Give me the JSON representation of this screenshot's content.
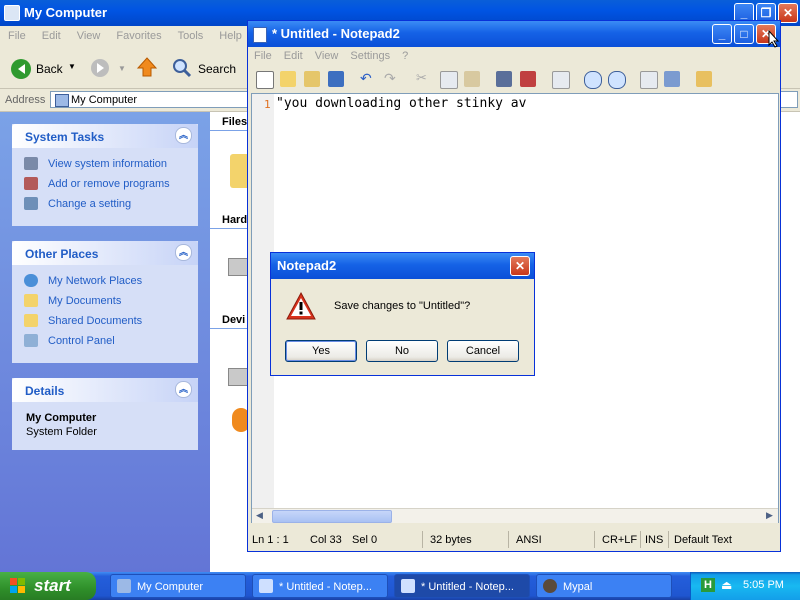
{
  "my_computer": {
    "title": "My Computer",
    "menu": [
      "File",
      "Edit",
      "View",
      "Favorites",
      "Tools",
      "Help"
    ],
    "toolbar": {
      "back": "Back",
      "search": "Search"
    },
    "address_label": "Address",
    "address_value": "My Computer",
    "system_tasks": {
      "title": "System Tasks",
      "items": [
        "View system information",
        "Add or remove programs",
        "Change a setting"
      ]
    },
    "other_places": {
      "title": "Other Places",
      "items": [
        "My Network Places",
        "My Documents",
        "Shared Documents",
        "Control Panel"
      ]
    },
    "details": {
      "title": "Details",
      "name": "My Computer",
      "type": "System Folder"
    },
    "content_sections": [
      "Files",
      "Hard",
      "Devi"
    ]
  },
  "notepad": {
    "title": "* Untitled - Notepad2",
    "menu": [
      "File",
      "Edit",
      "View",
      "Settings",
      "?"
    ],
    "line_number": "1",
    "text": "\"you downloading other stinky av",
    "status": {
      "position": "Ln 1 : 1",
      "col": "Col 33",
      "sel": "Sel 0",
      "size": "32 bytes",
      "encoding": "ANSI",
      "eol": "CR+LF",
      "ins": "INS",
      "scheme": "Default Text"
    }
  },
  "dialog": {
    "title": "Notepad2",
    "message": "Save changes to \"Untitled\"?",
    "buttons": {
      "yes": "Yes",
      "no": "No",
      "cancel": "Cancel"
    }
  },
  "taskbar": {
    "start": "start",
    "tasks": [
      "My Computer",
      "* Untitled - Notep...",
      "* Untitled - Notep...",
      "Mypal"
    ],
    "clock": "5:05 PM"
  },
  "colors": {
    "xp_blue": "#0054e3",
    "start_green": "#2f8f2a",
    "link_blue": "#215dc6",
    "error_red": "#d8321c"
  }
}
